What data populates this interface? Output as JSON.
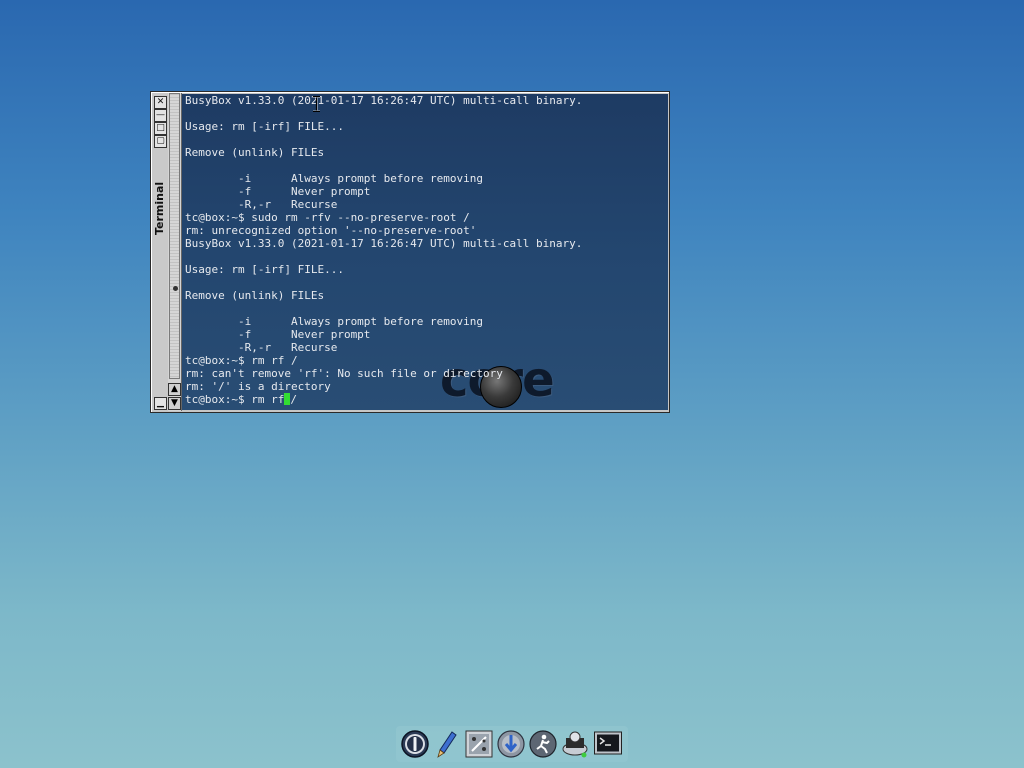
{
  "window": {
    "title": "Terminal",
    "buttons": {
      "close": "✕",
      "maximize": "□",
      "restore": "▢",
      "minimize": "—",
      "iconify": "▁"
    }
  },
  "scrollbar": {
    "up_arrow": "▲",
    "down_arrow": "▼"
  },
  "terminal": {
    "lines": [
      "BusyBox v1.33.0 (2021-01-17 16:26:47 UTC) multi-call binary.",
      "",
      "Usage: rm [-irf] FILE...",
      "",
      "Remove (unlink) FILEs",
      "",
      "        -i      Always prompt before removing",
      "        -f      Never prompt",
      "        -R,-r   Recurse",
      "tc@box:~$ sudo rm -rfv --no-preserve-root /",
      "rm: unrecognized option '--no-preserve-root'",
      "BusyBox v1.33.0 (2021-01-17 16:26:47 UTC) multi-call binary.",
      "",
      "Usage: rm [-irf] FILE...",
      "",
      "Remove (unlink) FILEs",
      "",
      "        -i      Always prompt before removing",
      "        -f      Never prompt",
      "        -R,-r   Recurse",
      "tc@box:~$ rm rf /",
      "rm: can't remove 'rf': No such file or directory",
      "rm: '/' is a directory"
    ],
    "prompt": "tc@box:~$ ",
    "current_input": "rm rf",
    "after_cursor": "/",
    "logo": {
      "text": "core"
    }
  },
  "dock": {
    "items": [
      {
        "name": "power-icon"
      },
      {
        "name": "editor-icon"
      },
      {
        "name": "control-panel-icon"
      },
      {
        "name": "install-icon"
      },
      {
        "name": "run-icon"
      },
      {
        "name": "mount-tool-icon"
      },
      {
        "name": "terminal-icon"
      }
    ]
  },
  "colors": {
    "terminal_bg": "#23466f",
    "terminal_fg": "#e6e9ee",
    "cursor": "#33dd33",
    "desktop_top": "#2a68b0",
    "desktop_bottom": "#8cc2cc"
  }
}
